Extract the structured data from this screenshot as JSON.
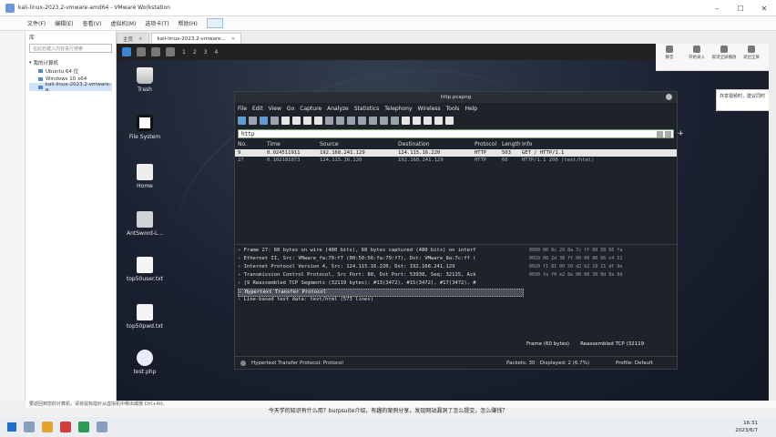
{
  "vmware": {
    "title": "kali-linux-2023.2-vmware-amd64 - VMware Workstation",
    "menu": [
      "文件(F)",
      "编辑(E)",
      "查看(V)",
      "虚拟机(M)",
      "选项卡(T)",
      "帮助(H)"
    ],
    "library_header": "库",
    "library_search": "在此处键入内容进行搜索",
    "tree_root": "我的计算机",
    "vms": [
      "Ubuntu 64 位",
      "Windows 10 x64",
      "kali-linux-2023.2-vmware-a"
    ],
    "tabs": [
      "主页",
      "kali-linux-2023.2-vmware..."
    ],
    "tools": [
      "静音",
      "开始录入",
      "取消全屏播放",
      "退出全屏"
    ],
    "status_text": "要返回到您的计算机，请将鼠标指针从虚拟机中移出或按 Ctrl+Alt。"
  },
  "kali": {
    "workspaces": [
      "1",
      "2",
      "3",
      "4"
    ],
    "desktop_icons": [
      "Trash",
      "File System",
      "Home",
      "AntSword-L...",
      "top50user.txt",
      "top50pwd.txt",
      "test.php"
    ]
  },
  "wireshark": {
    "title": "http.pcapng",
    "menu": [
      "File",
      "Edit",
      "View",
      "Go",
      "Capture",
      "Analyze",
      "Statistics",
      "Telephony",
      "Wireless",
      "Tools",
      "Help"
    ],
    "filter": "http",
    "columns": [
      "No.",
      "Time",
      "Source",
      "Destination",
      "Protocol",
      "Length",
      "Info"
    ],
    "packets": [
      {
        "no": "9",
        "time": "0.024511911",
        "src": "192.168.241.129",
        "dst": "124.115.16.220",
        "proto": "HTTP",
        "len": "503",
        "info": "GET / HTTP/1.1"
      },
      {
        "no": "27",
        "time": "0.102181073",
        "src": "124.115.16.220",
        "dst": "192.168.241.129",
        "proto": "HTTP",
        "len": "60",
        "info": "HTTP/1.1 200   (text/html)"
      }
    ],
    "details": [
      "Frame 27: 60 bytes on wire (480 bits), 60 bytes captured (480 bits) on interf",
      "Ethernet II, Src: VMware_fa:79:f7 (00:50:56:fa:79:f7), Dst: VMware_8a:7c:ff (",
      "Internet Protocol Version 4, Src: 124.115.16.220, Dst: 192.168.241.129",
      "Transmission Control Protocol, Src Port: 80, Dst Port: 53938, Seq: 32115, Ack",
      "[9 Reassembled TCP Segments (32119 bytes): #13(3472), #15(3472), #17(3472), #",
      "Hypertext Transfer Protocol",
      "Line-based text data: text/html (573 lines)"
    ],
    "hex": [
      "0000  00 0c 29 8a 7c ff 00 50  56 fa",
      "0010  00 2d 38 ff 00 00 80 06  c4 52",
      "0020  f1 81 00 50 d2 b2 18 21  df 9e",
      "0030  fa f0 e2 8e 00 00 30 0d  0a 0d"
    ],
    "byte_tabs": [
      "Frame (60 bytes)",
      "Reassembled TCP (32119"
    ],
    "status_left": "Hypertext Transfer Protocol: Protocol",
    "status_mid": "Packets: 30 · Displayed: 2 (6.7%)",
    "status_right": "Profile: Default"
  },
  "chat_text": "共享视频时，建议同时",
  "subtitle": "今天学的知识有什么用？burpsuite介绍，有趣的案例分享，发现网站漏洞了怎么提交，怎么赚钱？",
  "clock": {
    "time": "16:31",
    "date": "2023/6/7"
  }
}
